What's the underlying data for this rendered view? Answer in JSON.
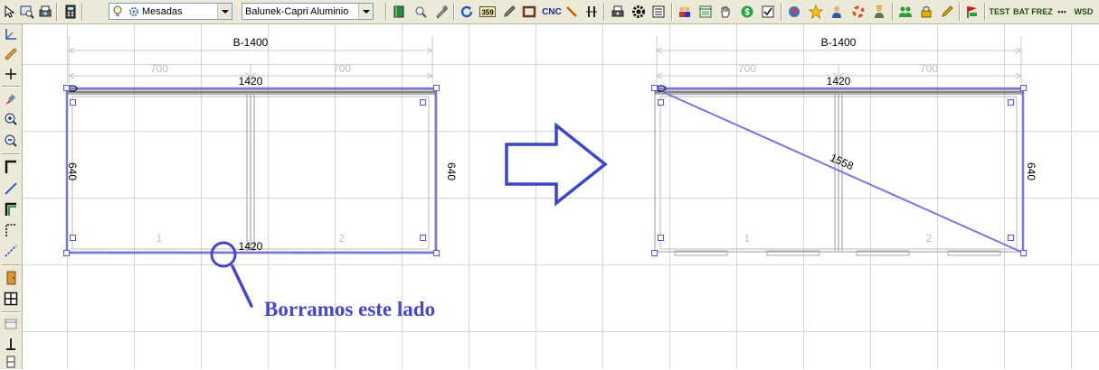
{
  "toolbar": {
    "mesadas_combo": {
      "value": "Mesadas",
      "icons": [
        "bulb-icon",
        "gear-icon"
      ]
    },
    "profile_combo": {
      "value": "Balunek-Capri Aluminio"
    },
    "cnc_label": "CNC",
    "tag_359": "359",
    "labels": {
      "test": "TEST",
      "bat": "BAT",
      "frez": "FREZ",
      "dots": "•••",
      "wsd": "WSD"
    },
    "icons": [
      "pointer-icon",
      "zoom-window-icon",
      "print-preview-icon",
      "calculator-icon",
      "book-icon",
      "search-icon",
      "tools-icon",
      "refresh-icon",
      "code-icon",
      "pencil-icon",
      "frame-icon",
      "knife-icon",
      "divider-icon",
      "printer-icon",
      "gear-icon",
      "list-icon",
      "users-icon",
      "window-icon",
      "hand-icon",
      "money-icon",
      "checkbox-icon",
      "globe-icon",
      "star-icon",
      "person-icon",
      "lifebuoy-icon",
      "worker-icon",
      "group-icon",
      "lock-icon",
      "edit-icon",
      "flag-icon"
    ]
  },
  "sidebar": {
    "icons": [
      "dimension-icon",
      "ruler-icon",
      "cross-icon",
      "brush-icon",
      "zoom-in-icon",
      "zoom-out-icon",
      "corner-profile-icon",
      "line-icon",
      "profile-l-icon",
      "dashed-frame-icon",
      "diagonal-icon",
      "door-icon",
      "grid-icon",
      "panel-icon",
      "stand-icon",
      "small-panel-icon"
    ]
  },
  "drawing_left": {
    "overall_label": "B-1400",
    "sub_left": "700",
    "sub_right": "700",
    "top_label": "1420",
    "left_side": "640",
    "right_side": "640",
    "bottom_label": "1420",
    "pane_1": "1",
    "pane_2": "2"
  },
  "drawing_right": {
    "overall_label": "B-1400",
    "sub_left": "700",
    "sub_right": "700",
    "top_label": "1420",
    "right_side": "640",
    "diagonal_label": "1558",
    "pane_1": "1",
    "pane_2": "2"
  },
  "annotation": {
    "caption": "Borramos este lado"
  },
  "colors": {
    "selection": "#7777dd",
    "arrow": "#3a46c6",
    "annotation": "#4646c8",
    "grid": "#d6d6d6",
    "dim": "#c8c8c8"
  }
}
